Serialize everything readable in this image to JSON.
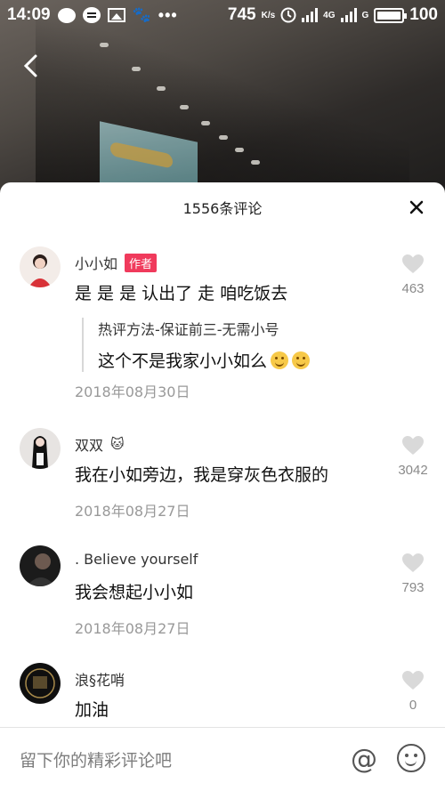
{
  "status_bar": {
    "time": "14:09",
    "network_speed": "745",
    "speed_unit": "K/s",
    "network_type_1": "4G",
    "network_type_2": "G",
    "battery": "100"
  },
  "sheet": {
    "title": "1556条评论"
  },
  "comments": [
    {
      "user": "小小如",
      "badge": "作者",
      "text": "是 是 是 认出了 走 咱吃饭去",
      "reply": {
        "user": "热评方法-保证前三-无需小号",
        "text": "这个不是我家小小如么"
      },
      "date": "2018年08月30日",
      "likes": "463"
    },
    {
      "user": "双双",
      "text": "我在小如旁边，我是穿灰色衣服的",
      "date": "2018年08月27日",
      "likes": "3042"
    },
    {
      "user": ". Believe yourself",
      "text": "我会想起小小如",
      "date": "2018年08月27日",
      "likes": "793"
    },
    {
      "user": "浪§花哨",
      "text": "加油",
      "likes": "0"
    }
  ],
  "input": {
    "placeholder": "留下你的精彩评论吧",
    "at_label": "@"
  },
  "colors": {
    "author_badge": "#f03a5c",
    "like_icon": "#d9d9d9",
    "date_text": "#999999"
  }
}
